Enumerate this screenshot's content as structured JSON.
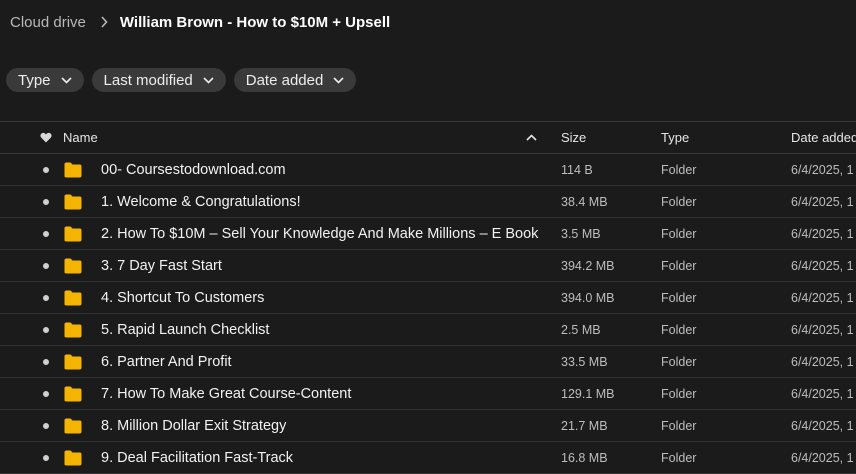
{
  "breadcrumb": {
    "root": "Cloud drive",
    "current": "William Brown - How to $10M + Upsell"
  },
  "filters": [
    {
      "label": "Type"
    },
    {
      "label": "Last modified"
    },
    {
      "label": "Date added"
    }
  ],
  "columns": {
    "name": "Name",
    "size": "Size",
    "type": "Type",
    "date_added": "Date added"
  },
  "colors": {
    "folder": "#f5b400",
    "background": "#1b1b1b",
    "chip": "#3a3a3a"
  },
  "rows": [
    {
      "name": "00- Coursestodownload.com",
      "size": "114 B",
      "type": "Folder",
      "date": "6/4/2025, 1"
    },
    {
      "name": "1. Welcome & Congratulations!",
      "size": "38.4 MB",
      "type": "Folder",
      "date": "6/4/2025, 1"
    },
    {
      "name": "2. How To $10M – Sell Your Knowledge And Make Millions – E Book",
      "size": "3.5 MB",
      "type": "Folder",
      "date": "6/4/2025, 1"
    },
    {
      "name": "3. 7 Day Fast Start",
      "size": "394.2 MB",
      "type": "Folder",
      "date": "6/4/2025, 1"
    },
    {
      "name": "4. Shortcut To Customers",
      "size": "394.0 MB",
      "type": "Folder",
      "date": "6/4/2025, 1"
    },
    {
      "name": "5. Rapid Launch Checklist",
      "size": "2.5 MB",
      "type": "Folder",
      "date": "6/4/2025, 1"
    },
    {
      "name": "6. Partner And Profit",
      "size": "33.5 MB",
      "type": "Folder",
      "date": "6/4/2025, 1"
    },
    {
      "name": "7. How To Make Great Course-Content",
      "size": "129.1 MB",
      "type": "Folder",
      "date": "6/4/2025, 1"
    },
    {
      "name": "8. Million Dollar Exit Strategy",
      "size": "21.7 MB",
      "type": "Folder",
      "date": "6/4/2025, 1"
    },
    {
      "name": "9. Deal Facilitation Fast-Track",
      "size": "16.8 MB",
      "type": "Folder",
      "date": "6/4/2025, 1"
    }
  ]
}
